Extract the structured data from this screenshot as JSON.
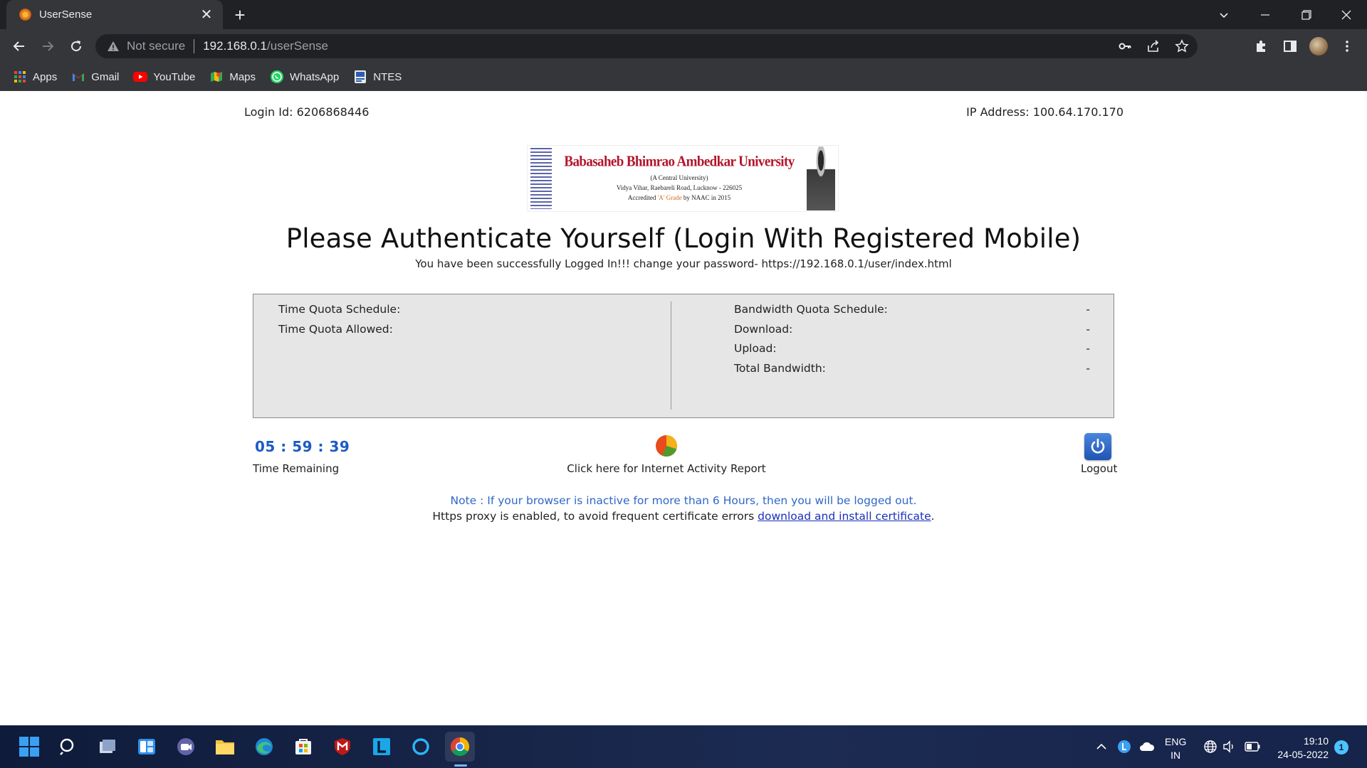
{
  "browser": {
    "tab_title": "UserSense",
    "tab_close": "✕",
    "new_tab": "+",
    "not_secure": "Not secure",
    "url_host": "192.168.0.1",
    "url_path": "/userSense",
    "bookmarks": [
      {
        "label": "Apps",
        "icon": "apps-grid-icon"
      },
      {
        "label": "Gmail",
        "icon": "gmail-icon"
      },
      {
        "label": "YouTube",
        "icon": "youtube-icon"
      },
      {
        "label": "Maps",
        "icon": "maps-icon"
      },
      {
        "label": "WhatsApp",
        "icon": "whatsapp-icon"
      },
      {
        "label": "NTES",
        "icon": "ntes-icon"
      }
    ]
  },
  "page": {
    "login_id": "Login Id: 6206868446",
    "ip_address": "IP Address: 100.64.170.170",
    "banner": {
      "university": "Babasaheb Bhimrao Ambedkar University",
      "subtitle": "(A Central University)",
      "address": "Vidya Vihar, Raebareli Road, Lucknow - 226025",
      "accredited_prefix": "Accredited ",
      "accredited_grade": "'A' Grade",
      "accredited_suffix": " by NAAC in 2015"
    },
    "heading": "Please Authenticate Yourself (Login With Registered Mobile)",
    "subheading": "You have been successfully Logged In!!! change your password- https://192.168.0.1/user/index.html",
    "quota_left": [
      {
        "label": "Time Quota Schedule:"
      },
      {
        "label": "Time Quota Allowed:"
      }
    ],
    "quota_right": [
      {
        "label": "Bandwidth Quota Schedule:",
        "value": "-"
      },
      {
        "label": "Download:",
        "value": "-"
      },
      {
        "label": "Upload:",
        "value": "-"
      },
      {
        "label": "Total Bandwidth:",
        "value": "-"
      }
    ],
    "timer": "05 : 59 : 39",
    "timer_label": "Time Remaining",
    "report_label": "Click here for Internet Activity Report",
    "logout_label": "Logout",
    "note": "Note : If your browser is inactive for more than 6 Hours, then you will be logged out.",
    "proxy_text": "Https proxy is enabled, to avoid frequent certificate errors ",
    "proxy_link": "download and install certificate",
    "proxy_end": "."
  },
  "taskbar": {
    "lang_top": "ENG",
    "lang_bottom": "IN",
    "time": "19:10",
    "date": "24-05-2022",
    "notification_count": "1"
  },
  "colors": {
    "accent_blue": "#1c5bc4",
    "note_blue": "#2f67c8",
    "university_red": "#b4152a"
  }
}
